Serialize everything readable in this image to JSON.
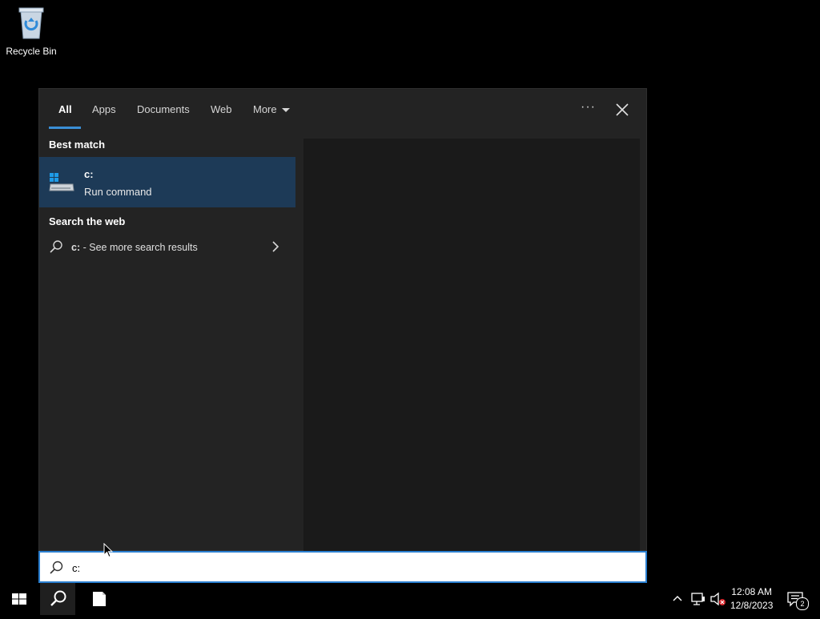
{
  "desktop": {
    "recycle_bin_label": "Recycle Bin"
  },
  "search_panel": {
    "tabs": [
      {
        "label": "All",
        "active": true
      },
      {
        "label": "Apps"
      },
      {
        "label": "Documents"
      },
      {
        "label": "Web"
      },
      {
        "label": "More"
      }
    ],
    "more_options_label": "···",
    "best_match_header": "Best match",
    "best_match": {
      "title": "c:",
      "subtitle": "Run command",
      "icon": "drive-icon"
    },
    "search_web_header": "Search the web",
    "web_result": {
      "query": "c:",
      "suffix": " - See more search results"
    }
  },
  "search_box": {
    "value": "c:",
    "icon": "search-icon"
  },
  "taskbar": {
    "clock_time": "12:08 AM",
    "clock_date": "12/8/2023",
    "notification_count": "2"
  },
  "colors": {
    "accent": "#2a7fd0",
    "selected_row": "#1d3a57",
    "panel_bg": "#232323"
  }
}
